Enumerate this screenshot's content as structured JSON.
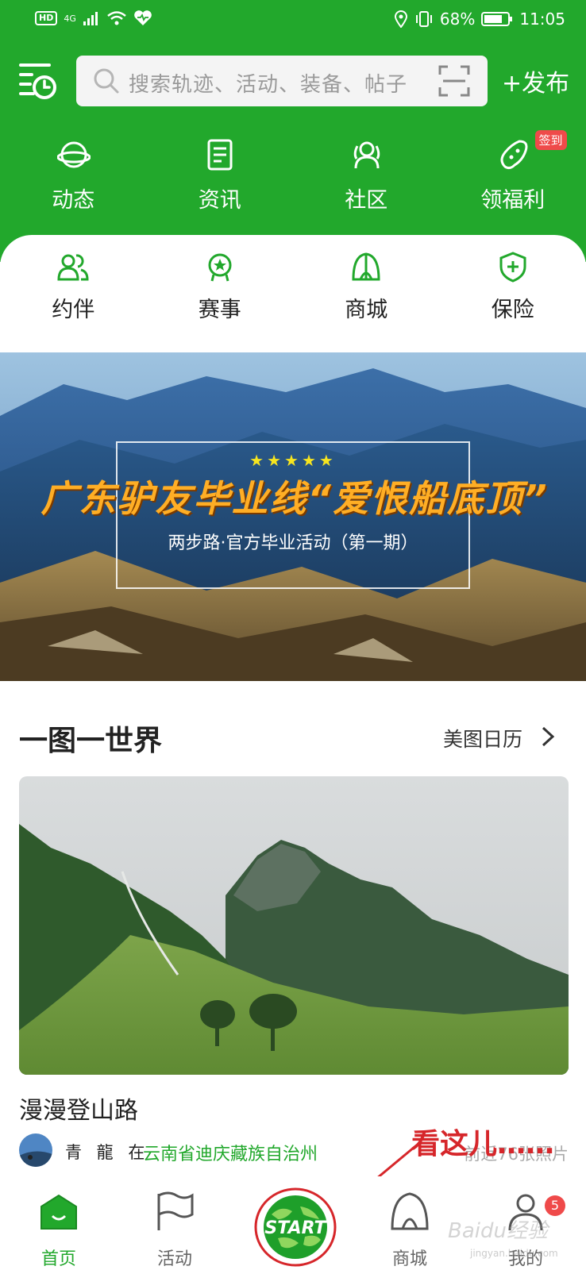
{
  "status_bar": {
    "left_badges": [
      "HD",
      "4G"
    ],
    "battery": "68%",
    "time": "11:05"
  },
  "top_bar": {
    "search_placeholder": "搜索轨迹、活动、装备、帖子",
    "publish_label": "+发布"
  },
  "primary_nav": [
    {
      "label": "动态",
      "icon": "planet-icon"
    },
    {
      "label": "资讯",
      "icon": "document-icon"
    },
    {
      "label": "社区",
      "icon": "people-icon"
    },
    {
      "label": "领福利",
      "icon": "bean-icon",
      "badge": "签到"
    }
  ],
  "secondary_nav": [
    {
      "label": "约伴",
      "icon": "partner-icon"
    },
    {
      "label": "赛事",
      "icon": "medal-icon"
    },
    {
      "label": "商城",
      "icon": "tent-icon"
    },
    {
      "label": "保险",
      "icon": "shield-plus-icon"
    }
  ],
  "banner": {
    "stars": "★★★★★",
    "title": "广东驴友毕业线“爱恨船底顶”",
    "subtitle": "两步路·官方毕业活动（第一期）"
  },
  "section": {
    "title": "一图一世界",
    "link": "美图日历"
  },
  "post": {
    "title": "漫漫登山路",
    "author": "青 龍 在",
    "location": "云南省迪庆藏族自治州",
    "photo_count": "前近76张照片"
  },
  "annotation": "看这儿……",
  "tab_bar": {
    "tabs": [
      {
        "label": "首页",
        "active": true
      },
      {
        "label": "活动",
        "active": false
      },
      {
        "label": "START",
        "active": false
      },
      {
        "label": "商城",
        "active": false
      },
      {
        "label": "我的",
        "active": false
      }
    ],
    "notification_count": "5"
  },
  "watermark": {
    "text": "Baidu经验",
    "sub": "jingyan.baidu.com"
  },
  "colors": {
    "brand_green": "#22a82c",
    "badge_red": "#ef4a4a",
    "annotation_red": "#d6262a"
  }
}
